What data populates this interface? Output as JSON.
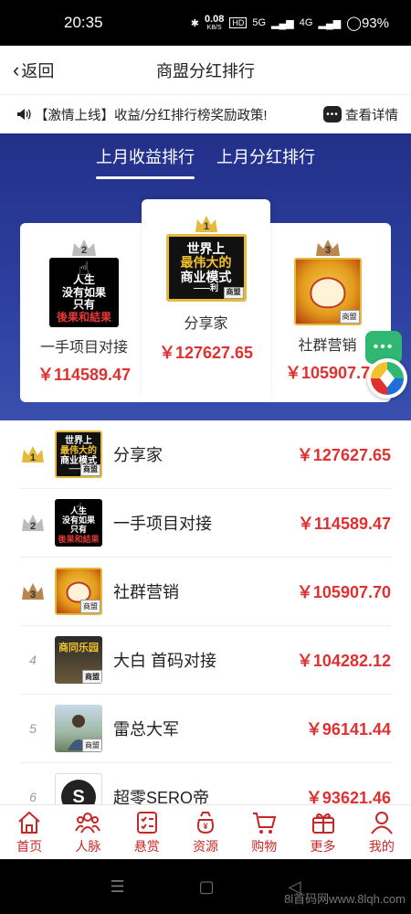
{
  "status": {
    "time": "20:35",
    "speed": "0.08",
    "speed_unit": "KB/S",
    "hd": "HD",
    "signal1": "5G",
    "signal2": "4G",
    "battery": "93%"
  },
  "nav": {
    "back_label": "返回",
    "title": "商盟分红排行"
  },
  "notice": {
    "text": "【激情上线】收益/分红排行榜奖励政策!",
    "detail_label": "查看详情"
  },
  "tabs": [
    {
      "label": "上月收益排行",
      "active": true
    },
    {
      "label": "上月分红排行",
      "active": false
    }
  ],
  "podium": {
    "first": {
      "rank": "1",
      "name": "分享家",
      "amount": "￥127627.65",
      "avatar_lines": [
        "世界上",
        "最伟大的",
        "商业模式",
        "——利"
      ],
      "avatar_tag": "商盟"
    },
    "second": {
      "rank": "2",
      "name": "一手项目对接",
      "amount": "￥114589.47",
      "avatar_lines": [
        "人生",
        "没有如果",
        "只有"
      ],
      "avatar_red": "後果和結果"
    },
    "third": {
      "rank": "3",
      "name": "社群营销",
      "amount": "￥105907.7",
      "avatar_tag": "商盟"
    }
  },
  "list": [
    {
      "rank": "1",
      "name": "分享家",
      "amount": "￥127627.65",
      "avatar": "book",
      "crown_color": "#e5b93a"
    },
    {
      "rank": "2",
      "name": "一手项目对接",
      "amount": "￥114589.47",
      "avatar": "dark",
      "crown_color": "#bcbcbc"
    },
    {
      "rank": "3",
      "name": "社群营销",
      "amount": "￥105907.70",
      "avatar": "cat",
      "crown_color": "#b8864f"
    },
    {
      "rank": "4",
      "name": "大白 首码对接",
      "amount": "￥104282.12",
      "avatar": "poster"
    },
    {
      "rank": "5",
      "name": "雷总大军",
      "amount": "￥96141.44",
      "avatar": "person"
    },
    {
      "rank": "6",
      "name": "超零SERO帝",
      "amount": "￥93621.46",
      "avatar": "sero"
    }
  ],
  "avatars": {
    "book_lines": [
      "世界上",
      "最伟大的",
      "商业模式",
      "——利"
    ],
    "dark_lines": [
      "人生",
      "没有如果",
      "只有"
    ],
    "dark_red": "後果和結果",
    "tag": "商盟",
    "poster_text": "商同乐园"
  },
  "tabbar": [
    {
      "label": "首页",
      "icon": "home-icon"
    },
    {
      "label": "人脉",
      "icon": "people-icon"
    },
    {
      "label": "悬赏",
      "icon": "task-icon"
    },
    {
      "label": "资源",
      "icon": "money-bag-icon"
    },
    {
      "label": "购物",
      "icon": "cart-icon"
    },
    {
      "label": "更多",
      "icon": "gift-icon"
    },
    {
      "label": "我的",
      "icon": "user-icon"
    }
  ],
  "system_nav": {
    "menu": "☰",
    "home": "▢",
    "back": "◁"
  },
  "watermark": "8l首码网www.8lqh.com",
  "colors": {
    "accent_red": "#e03131",
    "banner_blue": "#2c3f9e",
    "tab_red": "#c62828"
  }
}
